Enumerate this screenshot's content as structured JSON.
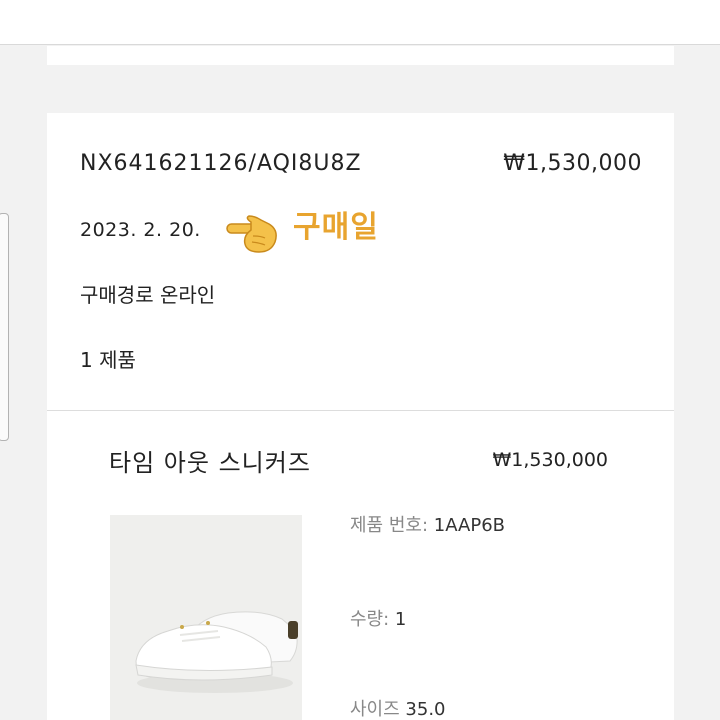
{
  "order": {
    "number": "NX641621126/AQI8U8Z",
    "total": "₩1,530,000",
    "date": "2023. 2. 20.",
    "annotation": "구매일",
    "channel": "구매경로 온라인",
    "item_count": "1 제품"
  },
  "item": {
    "name": "타임 아웃 스니커즈",
    "price": "₩1,530,000",
    "code_label": "제품 번호:",
    "code_value": "1AAP6B",
    "qty_label": "수량:",
    "qty_value": "1",
    "size_label": "사이즈",
    "size_value": "35.0"
  },
  "icons": {
    "annotation_pointer": "pointing-hand-icon"
  }
}
